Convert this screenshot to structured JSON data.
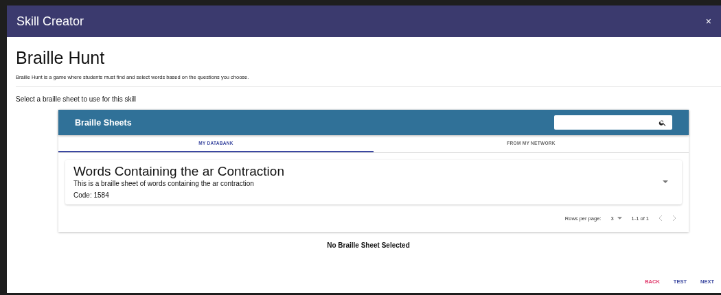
{
  "dialog": {
    "title": "Skill Creator",
    "close": "×"
  },
  "skill": {
    "name": "Braille Hunt",
    "description": "Braille Hunt is a game where students must find and select words based on the questions you choose."
  },
  "prompt": "Select a braille sheet to use for this skill",
  "sheets_panel": {
    "title": "Braille Sheets",
    "tabs": [
      {
        "label": "MY DATABANK",
        "selected": true
      },
      {
        "label": "FROM MY NETWORK",
        "selected": false
      }
    ],
    "items": [
      {
        "title": "Words Containing the ar Contraction",
        "description": "This is a braille sheet of words containing the ar contraction",
        "code": "Code: 1584",
        "expanded": false
      }
    ],
    "pagination": {
      "rows_label": "Rows per page:",
      "rows_value": "3",
      "range": "1-1 of 1"
    }
  },
  "selection_status": "No Braille Sheet Selected",
  "actions": [
    {
      "label": "BACK",
      "kind": "danger"
    },
    {
      "label": "TEST",
      "kind": "primary"
    },
    {
      "label": "NEXT",
      "kind": "primary"
    }
  ]
}
